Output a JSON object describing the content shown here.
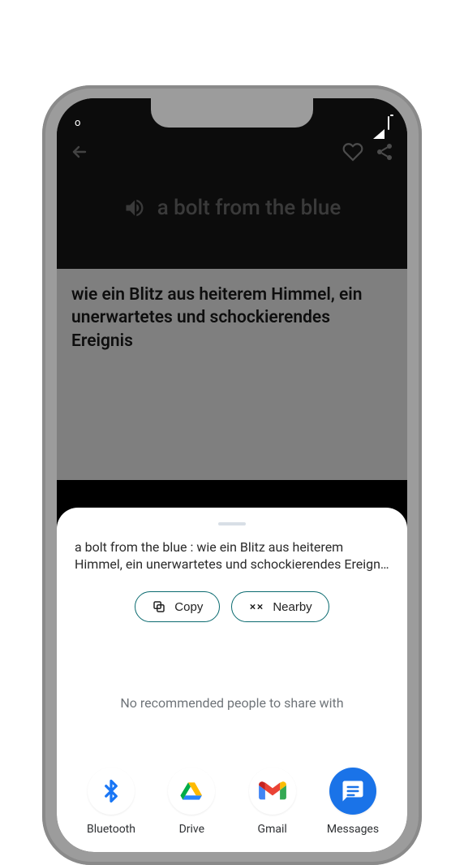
{
  "status": {
    "left": "o"
  },
  "app": {
    "title": "a bolt from the blue",
    "translation": "wie ein Blitz aus heiterem Himmel, ein unerwartetes und schockierendes Ereignis"
  },
  "share": {
    "text": "a bolt from the blue : wie ein Blitz aus heiterem Himmel, ein unerwartetes und schockierendes Ereign…",
    "copy_label": "Copy",
    "nearby_label": "Nearby",
    "no_recommended": "No recommended people to share with",
    "targets": [
      {
        "label": "Bluetooth"
      },
      {
        "label": "Drive"
      },
      {
        "label": "Gmail"
      },
      {
        "label": "Messages"
      }
    ]
  },
  "colors": {
    "accent": "#0b6b70",
    "sheet_bg": "#ffffff"
  }
}
